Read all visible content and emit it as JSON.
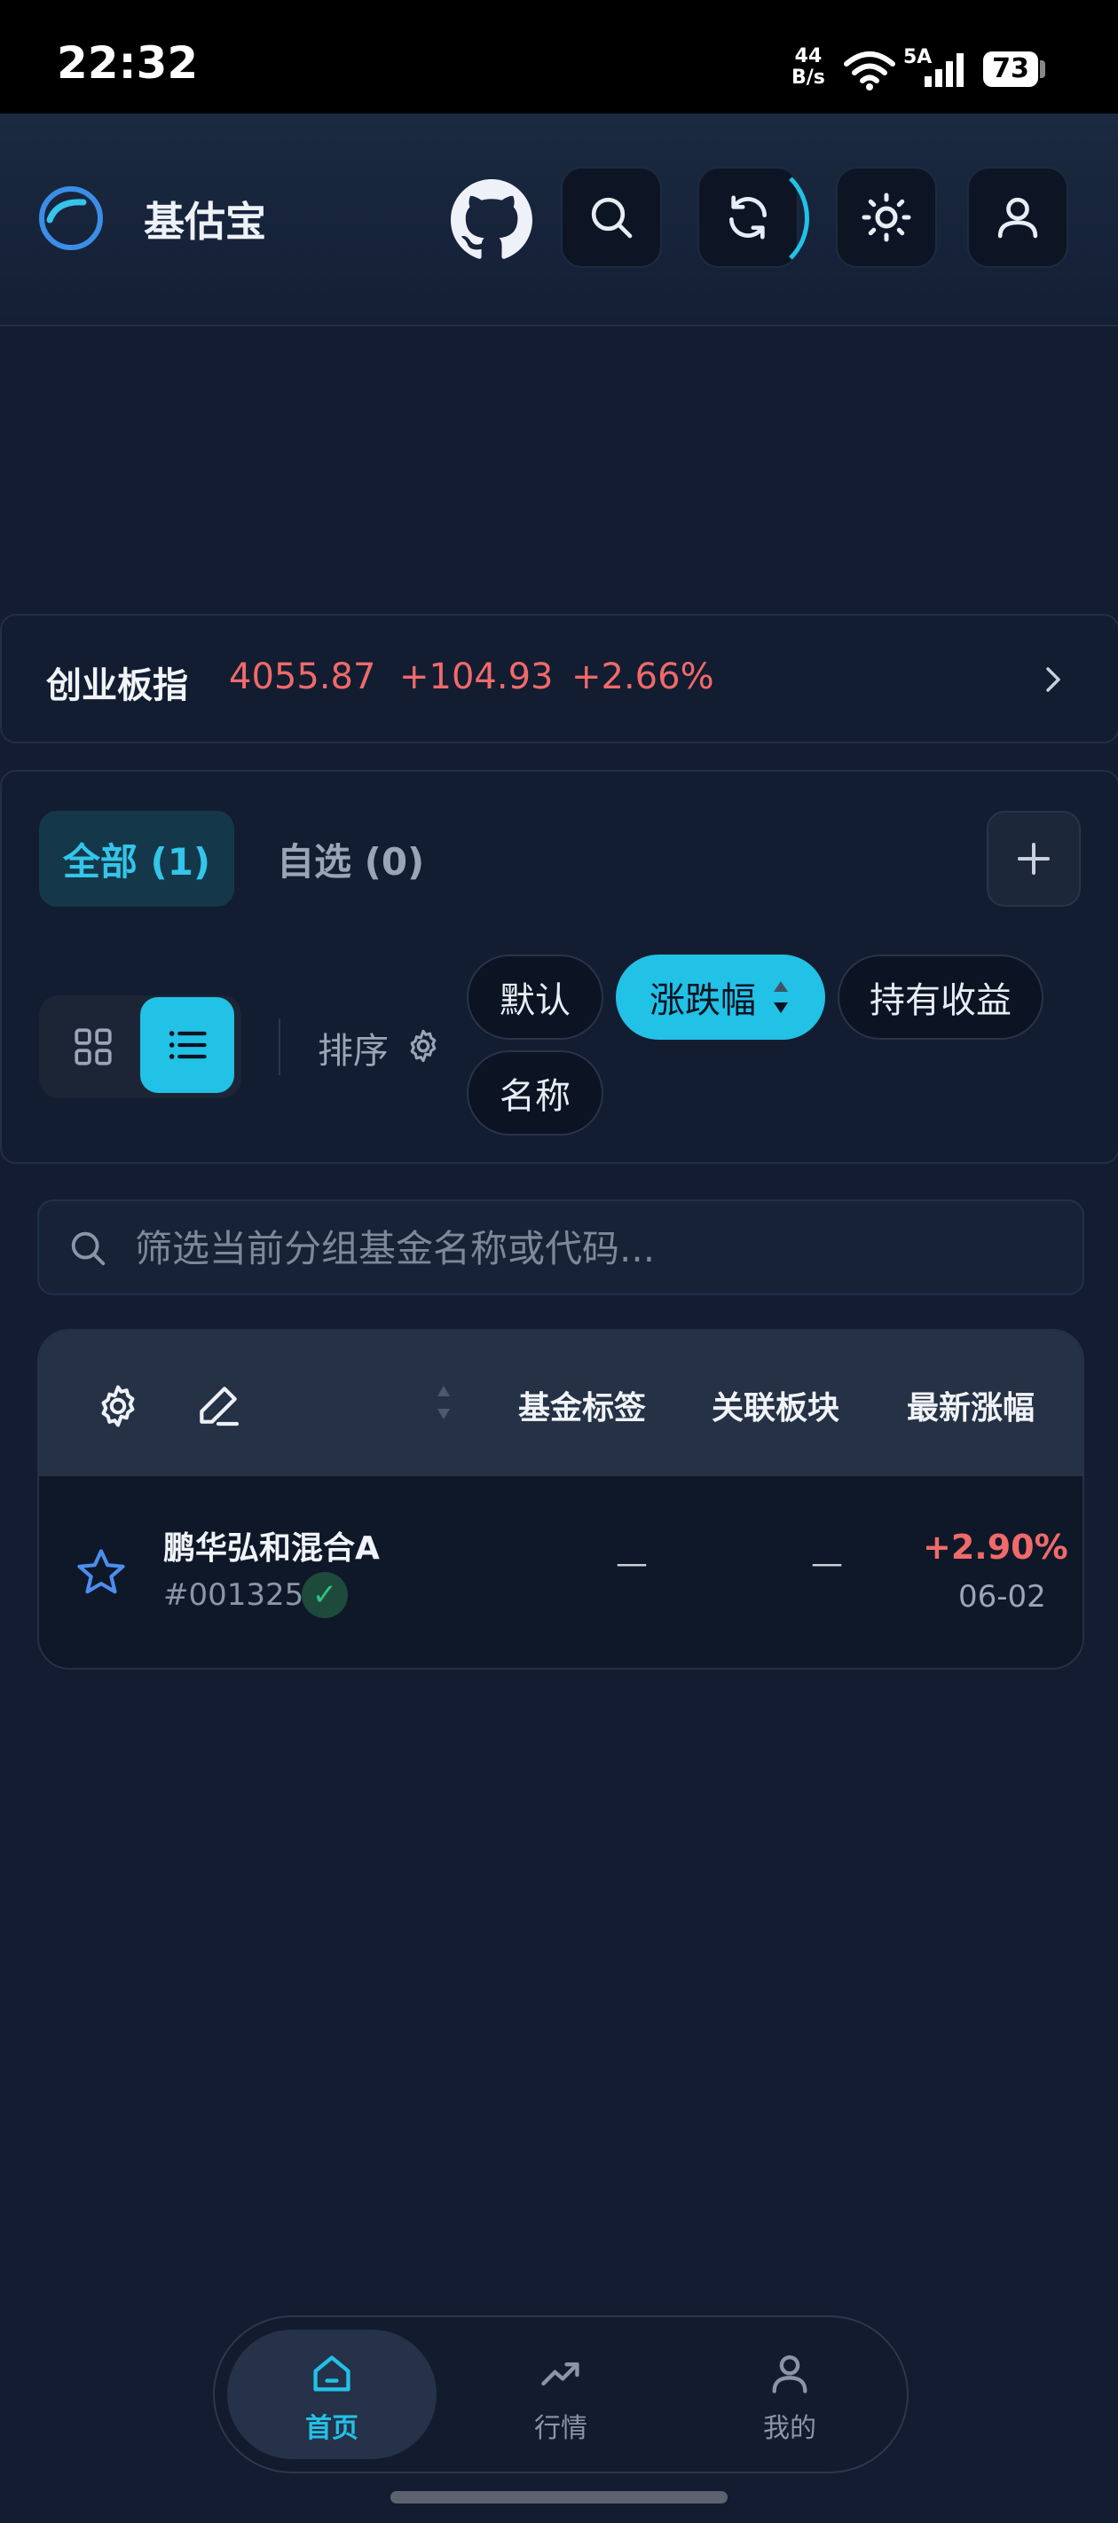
{
  "status_bar": {
    "time": "22:32",
    "speed_value": "44",
    "speed_unit": "B/s",
    "network": "5A",
    "battery": "73"
  },
  "header": {
    "app_title": "基估宝",
    "icons": [
      "github-icon",
      "search-icon",
      "refresh-icon",
      "theme-sun-icon",
      "user-icon"
    ]
  },
  "index": {
    "name": "创业板指",
    "value": "4055.87",
    "change": "+104.93",
    "change_pct": "+2.66%"
  },
  "groups": {
    "tabs": [
      {
        "label": "全部 (1)",
        "active": true
      },
      {
        "label": "自选 (0)",
        "active": false
      }
    ],
    "add_icon": "plus-icon"
  },
  "sort": {
    "label": "排序",
    "options": [
      {
        "label": "默认",
        "active": false
      },
      {
        "label": "涨跌幅",
        "active": true
      },
      {
        "label": "持有收益",
        "active": false
      },
      {
        "label": "名称",
        "active": false
      }
    ]
  },
  "search": {
    "placeholder": "筛选当前分组基金名称或代码..."
  },
  "table": {
    "columns": [
      "基金标签",
      "关联板块",
      "最新涨幅"
    ],
    "rows": [
      {
        "name": "鹏华弘和混合A",
        "code": "#001325",
        "verified_mark": "✓",
        "tag": "—",
        "sector": "—",
        "change": "+2.90%",
        "date": "06-02"
      }
    ]
  },
  "nav": {
    "items": [
      {
        "label": "首页",
        "active": true
      },
      {
        "label": "行情",
        "active": false
      },
      {
        "label": "我的",
        "active": false
      }
    ]
  },
  "colors": {
    "accent": "#22c1e6",
    "up": "#f06a6a",
    "background": "#131c30"
  }
}
